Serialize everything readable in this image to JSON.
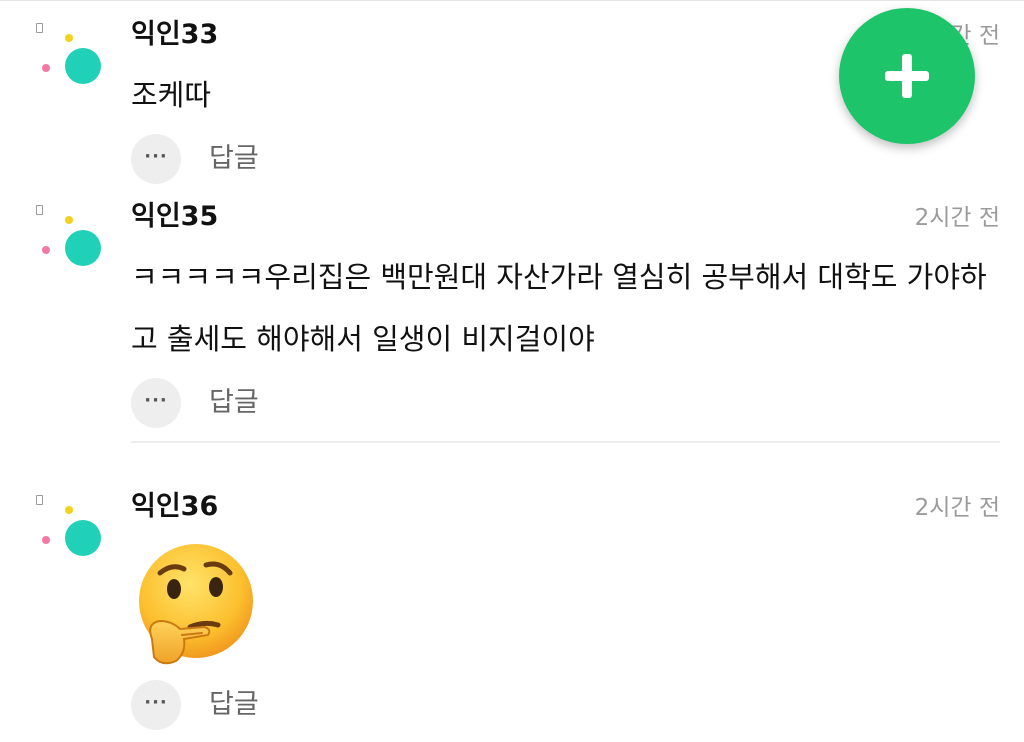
{
  "colors": {
    "fab": "#1ec469",
    "avatar_teal": "#21d1b7",
    "avatar_yellow": "#f2d21a",
    "avatar_pink": "#f07aa4",
    "timestamp": "#9b9b9b"
  },
  "fab": {
    "icon": "plus-icon"
  },
  "comments": [
    {
      "author": "익인33",
      "time": "2시간 전",
      "text": "조케따",
      "more_label": "···",
      "reply_label": "답글"
    },
    {
      "author": "익인35",
      "time": "2시간 전",
      "text": "ㅋㅋㅋㅋㅋ우리집은 백만원대 자산가라 열심히 공부해서 대학도 가야하고 출세도 해야해서 일생이 비지걸이야",
      "more_label": "···",
      "reply_label": "답글"
    },
    {
      "author": "익인36",
      "time": "2시간 전",
      "emoji": "thinking-face-icon",
      "more_label": "···",
      "reply_label": "답글"
    }
  ]
}
